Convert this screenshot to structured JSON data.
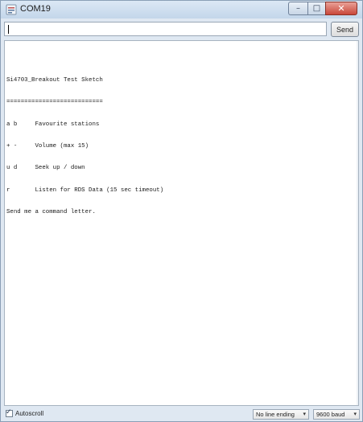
{
  "window": {
    "title": "COM19",
    "minimize_glyph": "–",
    "maximize_glyph": "□",
    "close_glyph": "✕"
  },
  "send_bar": {
    "input_value": "",
    "send_label": "Send"
  },
  "output": {
    "lines": [
      "Si4703_Breakout Test Sketch",
      "===========================",
      "a b     Favourite stations",
      "+ -     Volume (max 15)",
      "u d     Seek up / down",
      "r       Listen for RDS Data (15 sec timeout)",
      "Send me a command letter."
    ]
  },
  "status_bar": {
    "autoscroll_label": "Autoscroll",
    "autoscroll_checked": true,
    "line_ending_value": "No line ending",
    "baud_value": "9600 baud",
    "dropdown_arrow": "▾"
  },
  "colors": {
    "window_frame": "#dfe8f2",
    "close_button": "#c9473a"
  }
}
